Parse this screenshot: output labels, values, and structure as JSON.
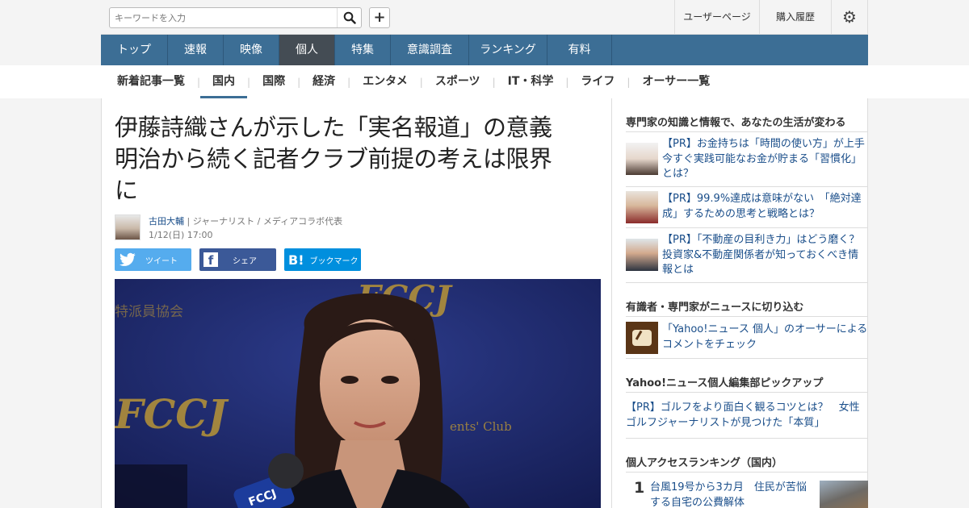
{
  "header": {
    "search_placeholder": "キーワードを入力",
    "user_page": "ユーザーページ",
    "purchase_history": "購入履歴"
  },
  "global_nav": [
    {
      "label": "トップ",
      "active": false
    },
    {
      "label": "速報",
      "active": false
    },
    {
      "label": "映像",
      "active": false
    },
    {
      "label": "個人",
      "active": true
    },
    {
      "label": "特集",
      "active": false
    },
    {
      "label": "意識調査",
      "active": false
    },
    {
      "label": "ランキング",
      "active": false
    },
    {
      "label": "有料",
      "active": false
    }
  ],
  "sub_nav": [
    {
      "label": "新着記事一覧",
      "active": false
    },
    {
      "label": "国内",
      "active": true
    },
    {
      "label": "国際",
      "active": false
    },
    {
      "label": "経済",
      "active": false
    },
    {
      "label": "エンタメ",
      "active": false
    },
    {
      "label": "スポーツ",
      "active": false
    },
    {
      "label": "IT・科学",
      "active": false
    },
    {
      "label": "ライフ",
      "active": false
    },
    {
      "label": "オーサー一覧",
      "active": false
    }
  ],
  "article": {
    "title_line1": "伊藤詩織さんが示した「実名報道」の意義",
    "title_line2": "明治から続く記者クラブ前提の考えは限界",
    "title_line3": "に",
    "author_name": "古田大輔",
    "author_role": "ジャーナリスト / メディアコラボ代表",
    "date": "1/12(日) 17:00",
    "share": {
      "tweet": "ツイート",
      "facebook": "シェア",
      "hatena": "ブックマーク"
    },
    "photo_text": {
      "fccj": "FCCJ",
      "club": "ents' Club",
      "jp_sign": "特派員協会"
    }
  },
  "sidebar": {
    "expert_heading": "専門家の知識と情報で、あなたの生活が変わる",
    "pr_items": [
      {
        "text": "【PR】お金持ちは「時間の使い方」が上手　今すぐ実践可能なお金が貯まる「習慣化」とは？"
      },
      {
        "text": "【PR】99.9%達成は意味がない　「絶対達成」するための思考と戦略とは？"
      },
      {
        "text": "【PR】「不動産の目利き力」はどう磨く？　投資家&不動産関係者が知っておくべき情報とは"
      }
    ],
    "comment_heading": "有識者・専門家がニュースに切り込む",
    "comment_link": "「Yahoo!ニュース 個人」のオーサーによるコメントをチェック",
    "pickup_heading": "Yahoo!ニュース個人編集部ピックアップ",
    "pickup_link": "【PR】ゴルフをより面白く観るコツとは？　女性ゴルフジャーナリストが見つけた「本質」",
    "ranking_heading": "個人アクセスランキング（国内）",
    "ranking": [
      {
        "rank": "1",
        "title": "台風19号から3カ月　住民が苦悩する自宅の公費解体"
      }
    ]
  },
  "colors": {
    "nav_blue": "#3c6e95",
    "nav_active": "#444c54",
    "link": "#1a4e8a",
    "twitter": "#55acee",
    "facebook": "#3b5998",
    "hatena": "#008fde"
  }
}
